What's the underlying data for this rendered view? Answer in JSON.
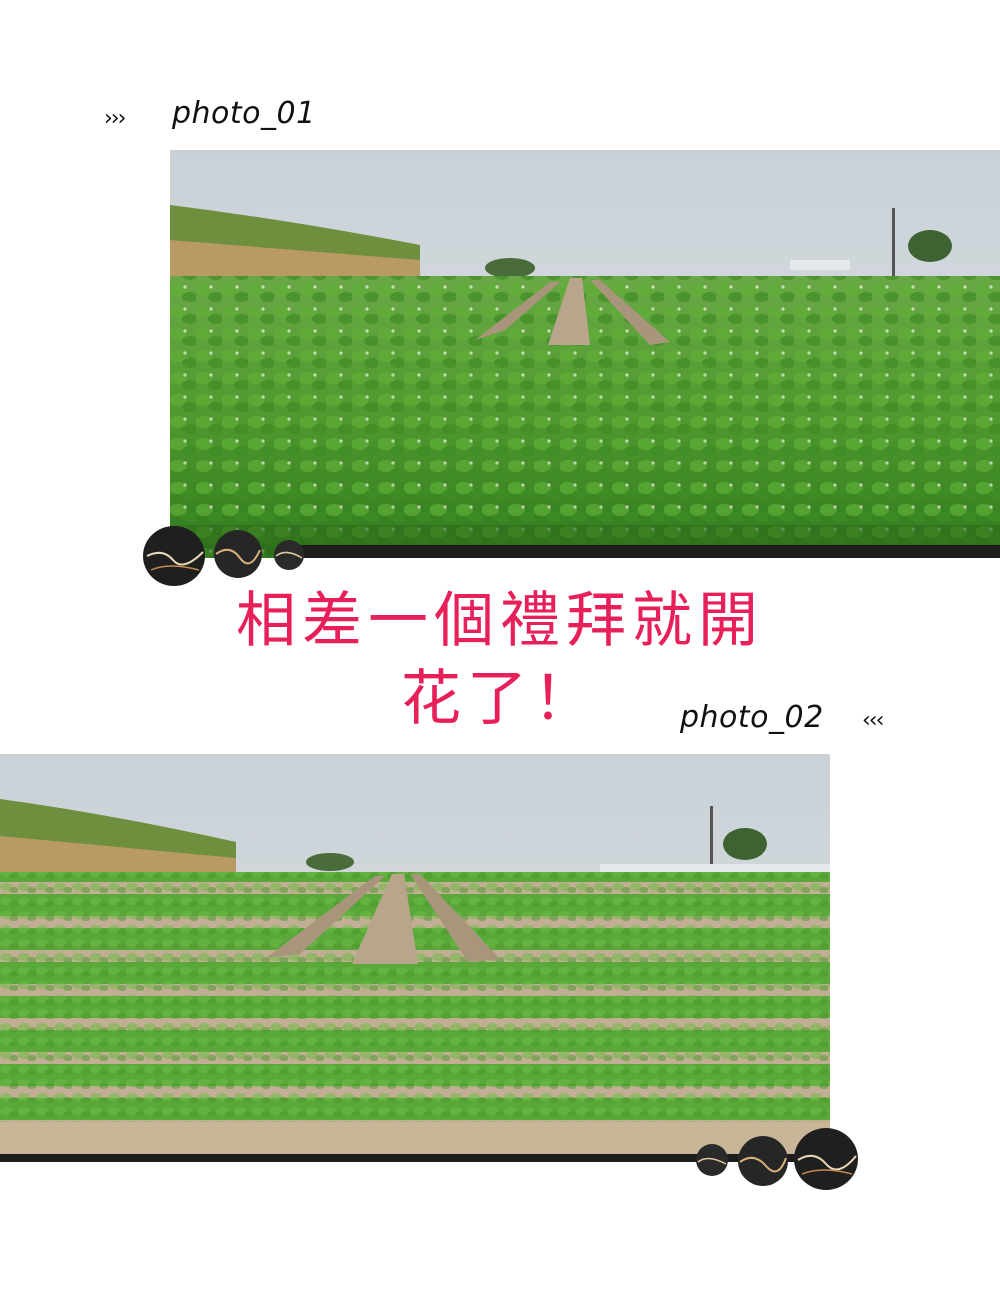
{
  "photo1": {
    "label": "photo_01",
    "chevrons": "›››"
  },
  "photo2": {
    "label": "photo_02",
    "chevrons": "‹‹‹"
  },
  "caption": {
    "line1": "相差一個禮拜就開",
    "line2": "花了！"
  },
  "colors": {
    "caption": "#e8205a",
    "sky": "#cdd4d9",
    "crop": "#4f9a2e",
    "soil": "#b9a58c",
    "stone": "#1e1e1e"
  },
  "icons": {
    "chevron_right": "chevrons-right-icon",
    "chevron_left": "chevrons-left-icon",
    "stone": "marble-stone-icon"
  }
}
